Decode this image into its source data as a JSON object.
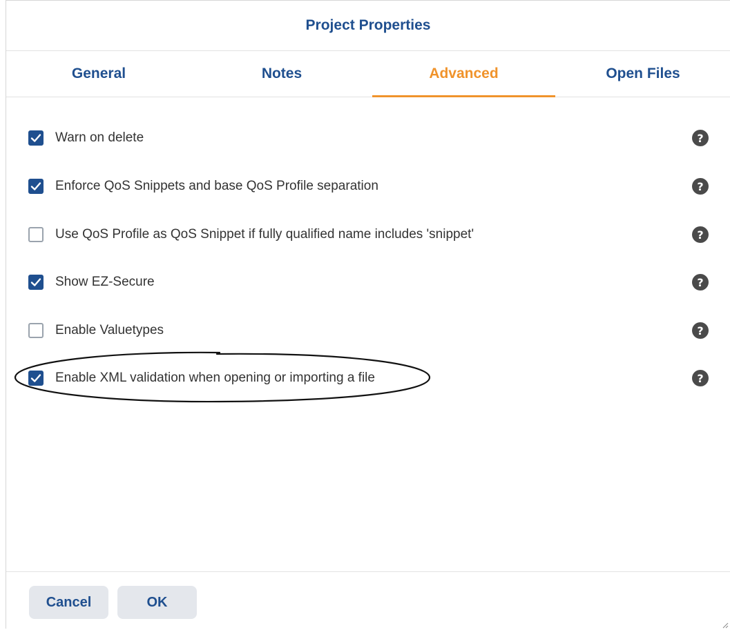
{
  "dialog": {
    "title": "Project Properties"
  },
  "tabs": [
    {
      "label": "General",
      "active": false
    },
    {
      "label": "Notes",
      "active": false
    },
    {
      "label": "Advanced",
      "active": true
    },
    {
      "label": "Open Files",
      "active": false
    }
  ],
  "options": [
    {
      "label": "Warn on delete",
      "checked": true,
      "help_icon": "question-circle-icon"
    },
    {
      "label": "Enforce QoS Snippets and base QoS Profile separation",
      "checked": true,
      "help_icon": "question-circle-icon"
    },
    {
      "label": "Use QoS Profile as QoS Snippet if fully qualified name includes 'snippet'",
      "checked": false,
      "help_icon": "question-circle-icon"
    },
    {
      "label": "Show EZ-Secure",
      "checked": true,
      "help_icon": "question-circle-icon"
    },
    {
      "label": "Enable Valuetypes",
      "checked": false,
      "help_icon": "question-circle-icon"
    },
    {
      "label": "Enable XML validation when opening or importing a file",
      "checked": true,
      "help_icon": "question-circle-icon"
    }
  ],
  "help_glyph": "?",
  "footer": {
    "cancel_label": "Cancel",
    "ok_label": "OK"
  },
  "colors": {
    "primary": "#1f4f8f",
    "accent": "#f0932b",
    "help_icon": "#4a4a4a",
    "button_bg": "#e4e7ec"
  }
}
